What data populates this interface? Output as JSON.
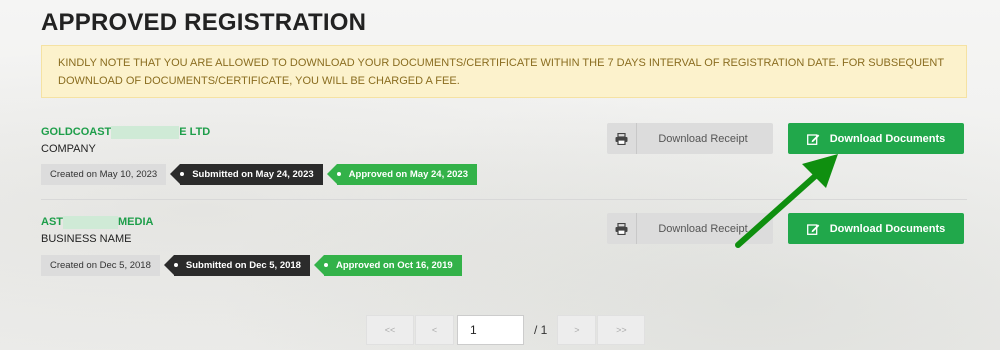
{
  "page": {
    "title": "APPROVED REGISTRATION"
  },
  "notice": {
    "text": "KINDLY NOTE THAT YOU ARE ALLOWED TO DOWNLOAD YOUR DOCUMENTS/CERTIFICATE WITHIN THE 7 DAYS INTERVAL OF REGISTRATION DATE. FOR SUBSEQUENT DOWNLOAD OF DOCUMENTS/CERTIFICATE, YOU WILL BE CHARGED A FEE."
  },
  "registrations": [
    {
      "name_prefix": "GOLDCOAST",
      "name_suffix": "E LTD",
      "type": "COMPANY",
      "created": "Created on May 10, 2023",
      "submitted": "Submitted on May 24, 2023",
      "approved": "Approved on May 24, 2023",
      "receipt_label": "Download Receipt",
      "docs_label": "Download Documents"
    },
    {
      "name_prefix": "AST",
      "name_suffix": "MEDIA",
      "type": "BUSINESS NAME",
      "created": "Created on Dec 5, 2018",
      "submitted": "Submitted on Dec 5, 2018",
      "approved": "Approved on Oct 16, 2019",
      "receipt_label": "Download Receipt",
      "docs_label": "Download Documents"
    }
  ],
  "pagination": {
    "first": "<<",
    "prev": "<",
    "current": "1",
    "total": "/ 1",
    "next": ">",
    "last": ">>"
  },
  "colors": {
    "accent_green": "#21a84b",
    "notice_bg": "#fcf2cc",
    "annotation_arrow": "#0f8f0f"
  },
  "icons": {
    "receipt": "printer-icon",
    "documents": "edit-icon"
  }
}
